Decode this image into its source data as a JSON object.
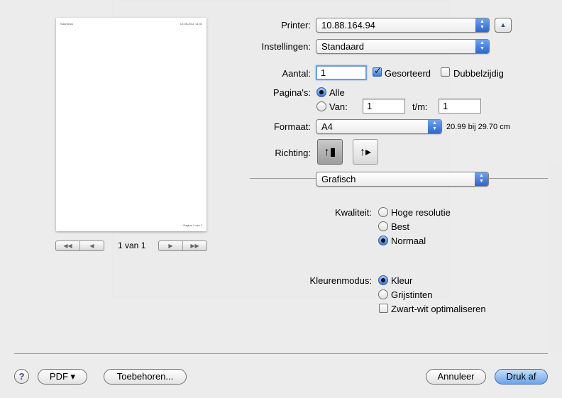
{
  "printer": {
    "label": "Printer:",
    "value": "10.88.164.94"
  },
  "settings": {
    "label": "Instellingen:",
    "value": "Standaard"
  },
  "copies": {
    "label": "Aantal:",
    "value": "1",
    "collated_label": "Gesorteerd",
    "collated": true,
    "duplex_label": "Dubbelzijdig",
    "duplex": false
  },
  "pages": {
    "label": "Pagina's:",
    "all_label": "Alle",
    "from_label": "Van:",
    "from_value": "1",
    "to_label": "t/m:",
    "to_value": "1",
    "selected": "all"
  },
  "paper": {
    "label": "Formaat:",
    "value": "A4",
    "size_text": "20.99 bij 29.70 cm"
  },
  "orientation": {
    "label": "Richting:",
    "selected": "portrait"
  },
  "section": {
    "value": "Grafisch"
  },
  "quality": {
    "label": "Kwaliteit:",
    "options": [
      "Hoge resolutie",
      "Best",
      "Normaal"
    ],
    "selected": "Normaal"
  },
  "color_mode": {
    "label": "Kleurenmodus:",
    "options": [
      "Kleur",
      "Grijstinten"
    ],
    "selected": "Kleur",
    "bw_opt_label": "Zwart-wit optimaliseren",
    "bw_opt": false
  },
  "preview": {
    "page_indicator": "1 van 1",
    "header_left": "Naamloos",
    "header_right": "10-06-2011 14:30",
    "footer": "Pagina 1 van 1"
  },
  "footer": {
    "help": "?",
    "pdf": "PDF ▾",
    "accessories": "Toebehoren...",
    "cancel": "Annuleer",
    "print": "Druk af"
  },
  "icons": {
    "popup_arrows": "updown-arrows-icon",
    "collapse": "triangle-up-icon",
    "portrait": "portrait-orientation-icon",
    "landscape": "landscape-orientation-icon"
  }
}
